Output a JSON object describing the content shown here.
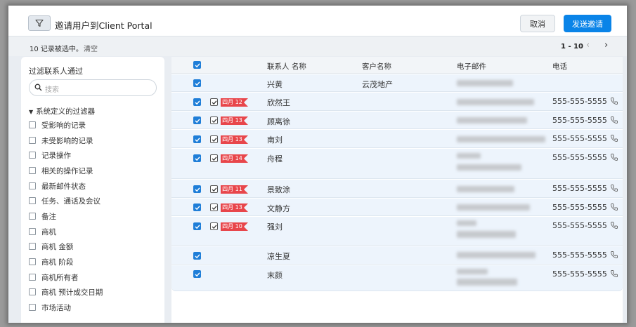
{
  "header": {
    "title": "邀请用户到Client Portal",
    "cancel_label": "取消",
    "invite_label": "发送邀请"
  },
  "subheader": {
    "selected_text": "10 记录被选中。",
    "clear_label": "清空",
    "pager": "1 - 10",
    "prev_icon": "‹",
    "next_icon": "›"
  },
  "sidebar": {
    "title": "过滤联系人通过",
    "search_placeholder": "搜索",
    "group_label": "系统定义的过滤器",
    "items": [
      {
        "label": "受影响的记录"
      },
      {
        "label": "未受影响的记录"
      },
      {
        "label": "记录操作"
      },
      {
        "label": "相关的操作记录"
      },
      {
        "label": "最新邮件状态"
      },
      {
        "label": "任务、通话及会议"
      },
      {
        "label": "备注"
      },
      {
        "label": "商机"
      },
      {
        "label": "商机 金额"
      },
      {
        "label": "商机 阶段"
      },
      {
        "label": "商机所有者"
      },
      {
        "label": "商机 预计成交日期"
      },
      {
        "label": "市场活动"
      }
    ]
  },
  "table": {
    "columns": [
      "联系人 名称",
      "客户名称",
      "电子邮件",
      "电话"
    ],
    "rows": [
      {
        "name": "兴黄",
        "account": "云茂地产",
        "task_date": "",
        "phone": ""
      },
      {
        "name": "欣然王",
        "account": "",
        "task_date": "四月 12",
        "phone": "555-555-5555"
      },
      {
        "name": "顾离徐",
        "account": "",
        "task_date": "四月 13",
        "phone": "555-555-5555"
      },
      {
        "name": "南刘",
        "account": "",
        "task_date": "四月 13",
        "phone": "555-555-5555"
      },
      {
        "name": "舟程",
        "account": "",
        "task_date": "四月 14",
        "phone": "555-555-5555"
      },
      {
        "name": "景致涂",
        "account": "",
        "task_date": "四月 11",
        "phone": "555-555-5555"
      },
      {
        "name": "文静方",
        "account": "",
        "task_date": "四月 13",
        "phone": "555-555-5555"
      },
      {
        "name": "强刘",
        "account": "",
        "task_date": "四月 10",
        "phone": "555-555-5555"
      },
      {
        "name": "凉生夏",
        "account": "",
        "task_date": "",
        "phone": "555-555-5555"
      },
      {
        "name": "末颜",
        "account": "",
        "task_date": "",
        "phone": "555-555-5555"
      }
    ]
  },
  "colors": {
    "primary": "#0a84e8",
    "checkbox_blue": "#1f7ed8",
    "flag_red": "#e8464b",
    "selected_row_bg": "#edf4fc"
  }
}
